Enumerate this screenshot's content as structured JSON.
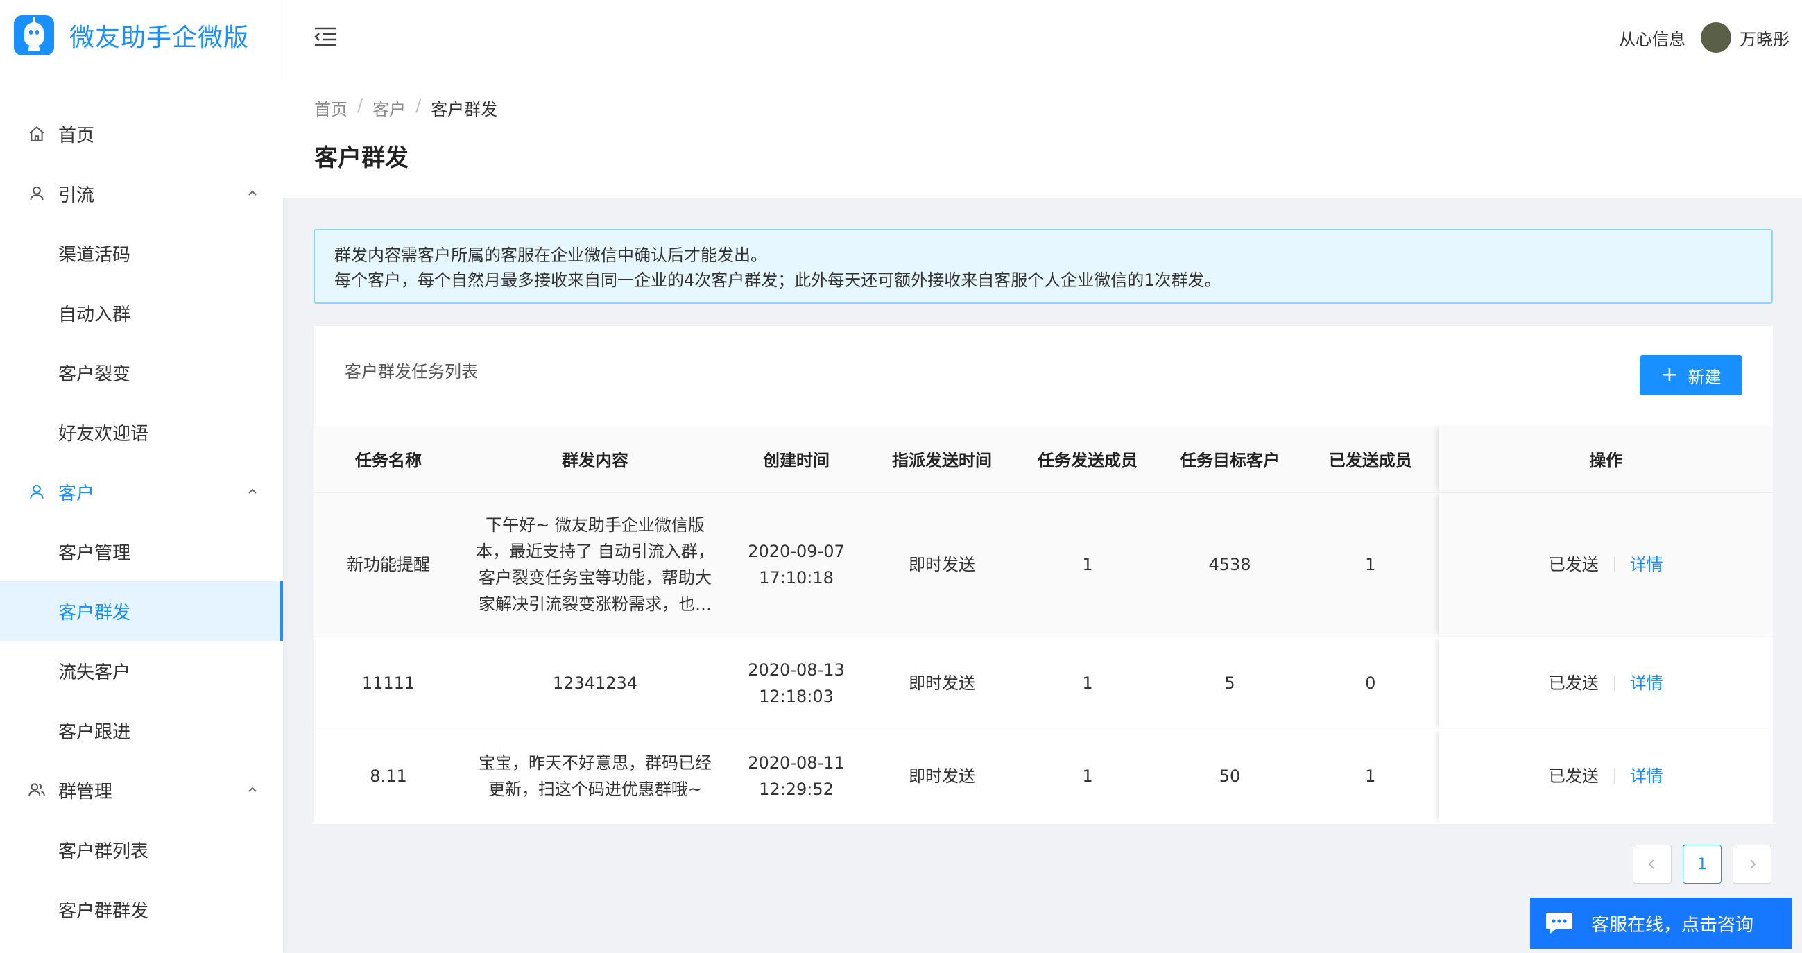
{
  "app": {
    "title": "微友助手企微版"
  },
  "header": {
    "company": "从心信息",
    "user": "万晓彤"
  },
  "sidebar": {
    "items": [
      {
        "label": "首页",
        "icon": "home-icon",
        "level": 0
      },
      {
        "label": "引流",
        "icon": "user-icon",
        "level": 0,
        "expanded": true
      },
      {
        "label": "渠道活码",
        "level": 1
      },
      {
        "label": "自动入群",
        "level": 1
      },
      {
        "label": "客户裂变",
        "level": 1
      },
      {
        "label": "好友欢迎语",
        "level": 1
      },
      {
        "label": "客户",
        "icon": "user-icon",
        "level": 0,
        "expanded": true,
        "active": true
      },
      {
        "label": "客户管理",
        "level": 1
      },
      {
        "label": "客户群发",
        "level": 1,
        "selected": true
      },
      {
        "label": "流失客户",
        "level": 1
      },
      {
        "label": "客户跟进",
        "level": 1
      },
      {
        "label": "群管理",
        "icon": "team-icon",
        "level": 0,
        "expanded": true
      },
      {
        "label": "客户群列表",
        "level": 1
      },
      {
        "label": "客户群群发",
        "level": 1
      }
    ]
  },
  "breadcrumb": {
    "items": [
      "首页",
      "客户",
      "客户群发"
    ]
  },
  "page": {
    "title": "客户群发"
  },
  "alert": {
    "line1": "群发内容需客户所属的客服在企业微信中确认后才能发出。",
    "line2": "每个客户，每个自然月最多接收来自同一企业的4次客户群发；此外每天还可额外接收来自客服个人企业微信的1次群发。"
  },
  "card": {
    "title": "客户群发任务列表",
    "new_button": "新建"
  },
  "table": {
    "columns": [
      "任务名称",
      "群发内容",
      "创建时间",
      "指派发送时间",
      "任务发送成员",
      "任务目标客户",
      "已发送成员",
      "操作"
    ],
    "rows": [
      {
        "name": "新功能提醒",
        "content": "下午好~ 微友助手企业微信版本，最近支持了 自动引流入群，客户裂变任务宝等功能，帮助大家解决引流裂变涨粉需求，也同样支持对客户的精...",
        "created_date": "2020-09-07",
        "created_time": "17:10:18",
        "send_time": "即时发送",
        "members": "1",
        "targets": "4538",
        "sent_members": "1",
        "status": "已发送",
        "action": "详情"
      },
      {
        "name": "11111",
        "content": "12341234",
        "created_date": "2020-08-13",
        "created_time": "12:18:03",
        "send_time": "即时发送",
        "members": "1",
        "targets": "5",
        "sent_members": "0",
        "status": "已发送",
        "action": "详情"
      },
      {
        "name": "8.11",
        "content": "宝宝，昨天不好意思，群码已经更新，扫这个码进优惠群哦~",
        "created_date": "2020-08-11",
        "created_time": "12:29:52",
        "send_time": "即时发送",
        "members": "1",
        "targets": "50",
        "sent_members": "1",
        "status": "已发送",
        "action": "详情"
      }
    ]
  },
  "pagination": {
    "current": "1"
  },
  "service": {
    "label": "客服在线，点击咨询"
  },
  "colors": {
    "accent": "#1890ff",
    "alert_bg": "#e6f7ff",
    "alert_border": "#91d5ff",
    "service_bg": "#1677ff"
  }
}
